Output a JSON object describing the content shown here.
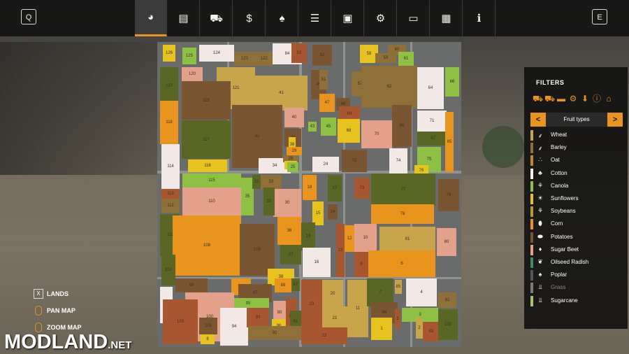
{
  "topbar": {
    "left_key": "Q",
    "right_key": "E",
    "tabs": [
      {
        "icon": "globe-icon",
        "glyph": "◕",
        "active": true
      },
      {
        "icon": "statistics-icon",
        "glyph": "▤"
      },
      {
        "icon": "tractor-icon",
        "glyph": "⛟"
      },
      {
        "icon": "money-icon",
        "glyph": "$"
      },
      {
        "icon": "cow-icon",
        "glyph": "♠"
      },
      {
        "icon": "contracts-icon",
        "glyph": "☰"
      },
      {
        "icon": "help-display-icon",
        "glyph": "▣"
      },
      {
        "icon": "garage-icon",
        "glyph": "⚙"
      },
      {
        "icon": "settings-monitor-icon",
        "glyph": "▭"
      },
      {
        "icon": "production-icon",
        "glyph": "▦"
      },
      {
        "icon": "info-icon",
        "glyph": "ℹ"
      }
    ]
  },
  "legend": {
    "lands_key": "X",
    "lands_label": "LANDS",
    "pan_label": "PAN MAP",
    "zoom_label": "ZOOM MAP"
  },
  "filters": {
    "title": "FILTERS",
    "category_icons": [
      "harvester-icon",
      "tractor-icon",
      "trailer-icon",
      "machinery-icon",
      "sell-point-icon",
      "warning-icon",
      "home-icon"
    ],
    "selector_label": "Fruit types",
    "prev": "<",
    "next": ">",
    "items": [
      {
        "label": "Wheat",
        "color": "#c8a54b",
        "icon": "wheat-icon",
        "glyph": "⸙"
      },
      {
        "label": "Barley",
        "color": "#8f7038",
        "icon": "barley-icon",
        "glyph": "⸙"
      },
      {
        "label": "Oat",
        "color": "#c08a31",
        "icon": "oat-icon",
        "glyph": "∴"
      },
      {
        "label": "Cotton",
        "color": "#f2f2f2",
        "icon": "cotton-icon",
        "glyph": "♣"
      },
      {
        "label": "Canola",
        "color": "#8ec043",
        "icon": "canola-icon",
        "glyph": "⚘"
      },
      {
        "label": "Sunflowers",
        "color": "#e8c21e",
        "icon": "sunflower-icon",
        "glyph": "☀"
      },
      {
        "label": "Soybeans",
        "color": "#b79a2a",
        "icon": "soybean-icon",
        "glyph": "⚘"
      },
      {
        "label": "Corn",
        "color": "#e9941d",
        "icon": "corn-icon",
        "glyph": "⬮"
      },
      {
        "label": "Potatoes",
        "color": "#7a5532",
        "icon": "potato-icon",
        "glyph": "⬬"
      },
      {
        "label": "Sugar Beet",
        "color": "#e3a08a",
        "icon": "sugar-beet-icon",
        "glyph": "♦"
      },
      {
        "label": "Oilseed Radish",
        "color": "#3f8e63",
        "icon": "radish-icon",
        "glyph": "❦"
      },
      {
        "label": "Poplar",
        "color": "#55575a",
        "icon": "poplar-icon",
        "glyph": "♠"
      },
      {
        "label": "Grass",
        "color": "#7c7c7c",
        "icon": "grass-icon",
        "glyph": "⫫",
        "dim": true
      },
      {
        "label": "Sugarcane",
        "color": "#a4c56a",
        "icon": "sugarcane-icon",
        "glyph": "⫫"
      }
    ]
  },
  "map": {
    "fields": [
      {
        "n": "126",
        "c": "#e8c21e"
      },
      {
        "n": "125",
        "c": "#8ec043"
      },
      {
        "n": "124",
        "c": "#f2e9e6"
      },
      {
        "n": "123",
        "c": "#8f7038"
      },
      {
        "n": "122",
        "c": "#8f7038"
      },
      {
        "n": "84",
        "c": "#f2e9e6"
      },
      {
        "n": "53",
        "c": "#a8562f"
      },
      {
        "n": "52",
        "c": "#7a5532"
      },
      {
        "n": "58",
        "c": "#e8c21e"
      },
      {
        "n": "59",
        "c": "#8f7038"
      },
      {
        "n": "60",
        "c": "#8f7038"
      },
      {
        "n": "61",
        "c": "#8ec043"
      },
      {
        "n": "127",
        "c": "#5a6624"
      },
      {
        "n": "120",
        "c": "#e3a08a"
      },
      {
        "n": "121",
        "c": "#c8a54b"
      },
      {
        "n": "41",
        "c": "#c8a54b"
      },
      {
        "n": "49",
        "c": "#7a5532"
      },
      {
        "n": "51",
        "c": "#8f7038"
      },
      {
        "n": "57",
        "c": "#8f7038"
      },
      {
        "n": "62",
        "c": "#8f7038"
      },
      {
        "n": "64",
        "c": "#f2e9e6"
      },
      {
        "n": "66",
        "c": "#8ec043"
      },
      {
        "n": "119",
        "c": "#7a5532"
      },
      {
        "n": "47",
        "c": "#e9941d"
      },
      {
        "n": "46",
        "c": "#7a5532"
      },
      {
        "n": "63",
        "c": "#a8562f"
      },
      {
        "n": "118",
        "c": "#e9941d"
      },
      {
        "n": "117",
        "c": "#5a6624"
      },
      {
        "n": "42",
        "c": "#7a5532"
      },
      {
        "n": "40",
        "c": "#e3a08a"
      },
      {
        "n": "43",
        "c": "#8ec043"
      },
      {
        "n": "45",
        "c": "#8ec043"
      },
      {
        "n": "68",
        "c": "#e8c21e"
      },
      {
        "n": "69",
        "c": "#7a5532"
      },
      {
        "n": "71",
        "c": "#f2e9e6"
      },
      {
        "n": "70",
        "c": "#e3a08a"
      },
      {
        "n": "39",
        "c": "#7a5532"
      },
      {
        "n": "38",
        "c": "#e8c21e"
      },
      {
        "n": "67",
        "c": "#5a6624"
      },
      {
        "n": "65",
        "c": "#e9941d"
      },
      {
        "n": "114",
        "c": "#f2e9e6"
      },
      {
        "n": "116",
        "c": "#e8c21e"
      },
      {
        "n": "34",
        "c": "#f2e9e6"
      },
      {
        "n": "29",
        "c": "#e9941d"
      },
      {
        "n": "28",
        "c": "#8f7038"
      },
      {
        "n": "26",
        "c": "#e8c21e"
      },
      {
        "n": "25",
        "c": "#8ec043"
      },
      {
        "n": "24",
        "c": "#f2e9e6"
      },
      {
        "n": "72",
        "c": "#7a5532"
      },
      {
        "n": "74",
        "c": "#f2e9e6"
      },
      {
        "n": "75",
        "c": "#8ec043"
      },
      {
        "n": "76",
        "c": "#e8c21e"
      },
      {
        "n": "115",
        "c": "#8ec043"
      },
      {
        "n": "113",
        "c": "#a8562f"
      },
      {
        "n": "112",
        "c": "#8f7038"
      },
      {
        "n": "110",
        "c": "#e3a08a"
      },
      {
        "n": "35",
        "c": "#8ec043"
      },
      {
        "n": "32",
        "c": "#5a6624"
      },
      {
        "n": "33",
        "c": "#8f7038"
      },
      {
        "n": "30",
        "c": "#e3a08a"
      },
      {
        "n": "31",
        "c": "#5a6624"
      },
      {
        "n": "18",
        "c": "#e9941d"
      },
      {
        "n": "17",
        "c": "#5a6624"
      },
      {
        "n": "73",
        "c": "#a8562f"
      },
      {
        "n": "77",
        "c": "#5a6624"
      },
      {
        "n": "79",
        "c": "#7a5532"
      },
      {
        "n": "111",
        "c": "#5a6624"
      },
      {
        "n": "108",
        "c": "#e9941d"
      },
      {
        "n": "15",
        "c": "#e8c21e"
      },
      {
        "n": "14",
        "c": "#7a5532"
      },
      {
        "n": "78",
        "c": "#e9941d"
      },
      {
        "n": "36",
        "c": "#e9941d"
      },
      {
        "n": "19",
        "c": "#5a6624"
      },
      {
        "n": "16",
        "c": "#f2e9e6"
      },
      {
        "n": "13",
        "c": "#a8562f"
      },
      {
        "n": "12",
        "c": "#e9941d"
      },
      {
        "n": "10",
        "c": "#e3a08a"
      },
      {
        "n": "81",
        "c": "#c8a54b"
      },
      {
        "n": "80",
        "c": "#e3a08a"
      },
      {
        "n": "37",
        "c": "#5a6624"
      },
      {
        "n": "107",
        "c": "#5a6624"
      },
      {
        "n": "109",
        "c": "#7a5532"
      },
      {
        "n": "38",
        "c": "#e8c21e"
      },
      {
        "n": "9",
        "c": "#a8562f"
      },
      {
        "n": "6",
        "c": "#e9941d"
      },
      {
        "n": "99",
        "c": "#7a5532"
      },
      {
        "n": "98",
        "c": "#e9941d"
      },
      {
        "n": "88",
        "c": "#e9941d"
      },
      {
        "n": "87",
        "c": "#5a6624"
      },
      {
        "n": "23",
        "c": "#a8562f"
      },
      {
        "n": "20",
        "c": "#c8a54b"
      },
      {
        "n": "11",
        "c": "#c8a54b"
      },
      {
        "n": "7",
        "c": "#5a6624"
      },
      {
        "n": "85",
        "c": "#c8a54b"
      },
      {
        "n": "4",
        "c": "#f2e9e6"
      },
      {
        "n": "105",
        "c": "#f2e9e6"
      },
      {
        "n": "97",
        "c": "#7a5532"
      },
      {
        "n": "95",
        "c": "#8ec043"
      },
      {
        "n": "89",
        "c": "#a8562f"
      },
      {
        "n": "82",
        "c": "#8f7038"
      },
      {
        "n": "100",
        "c": "#e3a08a"
      },
      {
        "n": "90",
        "c": "#e3a08a"
      },
      {
        "n": "94",
        "c": "#f2e9e6"
      },
      {
        "n": "93",
        "c": "#a8562f"
      },
      {
        "n": "96",
        "c": "#e8c21e"
      },
      {
        "n": "91",
        "c": "#5a6624"
      },
      {
        "n": "21",
        "c": "#c8a54b"
      },
      {
        "n": "86",
        "c": "#7a5532"
      },
      {
        "n": "5",
        "c": "#a8562f"
      },
      {
        "n": "3",
        "c": "#8ec043"
      },
      {
        "n": "103",
        "c": "#a8562f"
      },
      {
        "n": "101",
        "c": "#7a5532"
      },
      {
        "n": "92",
        "c": "#8f7038"
      },
      {
        "n": "22",
        "c": "#a8562f"
      },
      {
        "n": "1",
        "c": "#e8c21e"
      },
      {
        "n": "2",
        "c": "#c8a54b"
      },
      {
        "n": "83",
        "c": "#a8562f"
      },
      {
        "n": "102",
        "c": "#5a6624"
      },
      {
        "n": "8",
        "c": "#e8c21e"
      }
    ]
  },
  "watermark": {
    "text": "MODLAND",
    "suffix": ".NET"
  }
}
